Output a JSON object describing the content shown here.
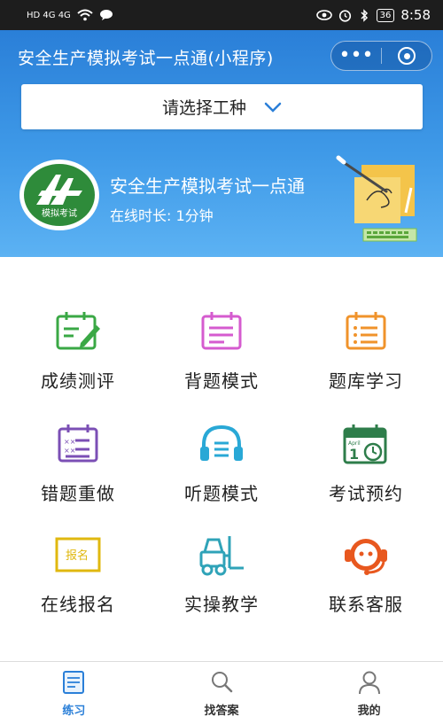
{
  "status_bar": {
    "left_text": "HD 4G 4G",
    "time": "8:58",
    "battery": "36"
  },
  "header": {
    "title": "安全生产模拟考试一点通(小程序)",
    "more_icon": "more-dots-icon",
    "close_icon": "close-miniprogram-icon"
  },
  "selector": {
    "label": "请选择工种"
  },
  "banner": {
    "logo_text": "模拟考试",
    "exam_title": "安全生产模拟考试一点通",
    "online_time": "在线时长: 1分钟"
  },
  "menu": [
    {
      "label": "成绩测评",
      "icon": "score-edit-icon",
      "color": "#3aa845"
    },
    {
      "label": "背题模式",
      "icon": "memorize-list-icon",
      "color": "#d55bcf"
    },
    {
      "label": "题库学习",
      "icon": "question-bank-icon",
      "color": "#f0932b"
    },
    {
      "label": "错题重做",
      "icon": "wrong-questions-icon",
      "color": "#7b4fb5"
    },
    {
      "label": "听题模式",
      "icon": "headphones-icon",
      "color": "#29a8d6"
    },
    {
      "label": "考试预约",
      "icon": "calendar-clock-icon",
      "color": "#2e7d4a"
    },
    {
      "label": "在线报名",
      "icon": "signup-badge-icon",
      "color": "#e0b80f"
    },
    {
      "label": "实操教学",
      "icon": "forklift-icon",
      "color": "#2fa3b8"
    },
    {
      "label": "联系客服",
      "icon": "customer-service-icon",
      "color": "#e8581f"
    }
  ],
  "signup_badge_text": "报名",
  "calendar_month": "April",
  "calendar_day": "1",
  "tabbar": [
    {
      "label": "练习",
      "icon": "practice-icon",
      "active": true
    },
    {
      "label": "找答案",
      "icon": "search-icon",
      "active": false
    },
    {
      "label": "我的",
      "icon": "user-icon",
      "active": false
    }
  ],
  "colors": {
    "primary": "#2a7fd8",
    "header_gradient_end": "#5cb2f3"
  }
}
